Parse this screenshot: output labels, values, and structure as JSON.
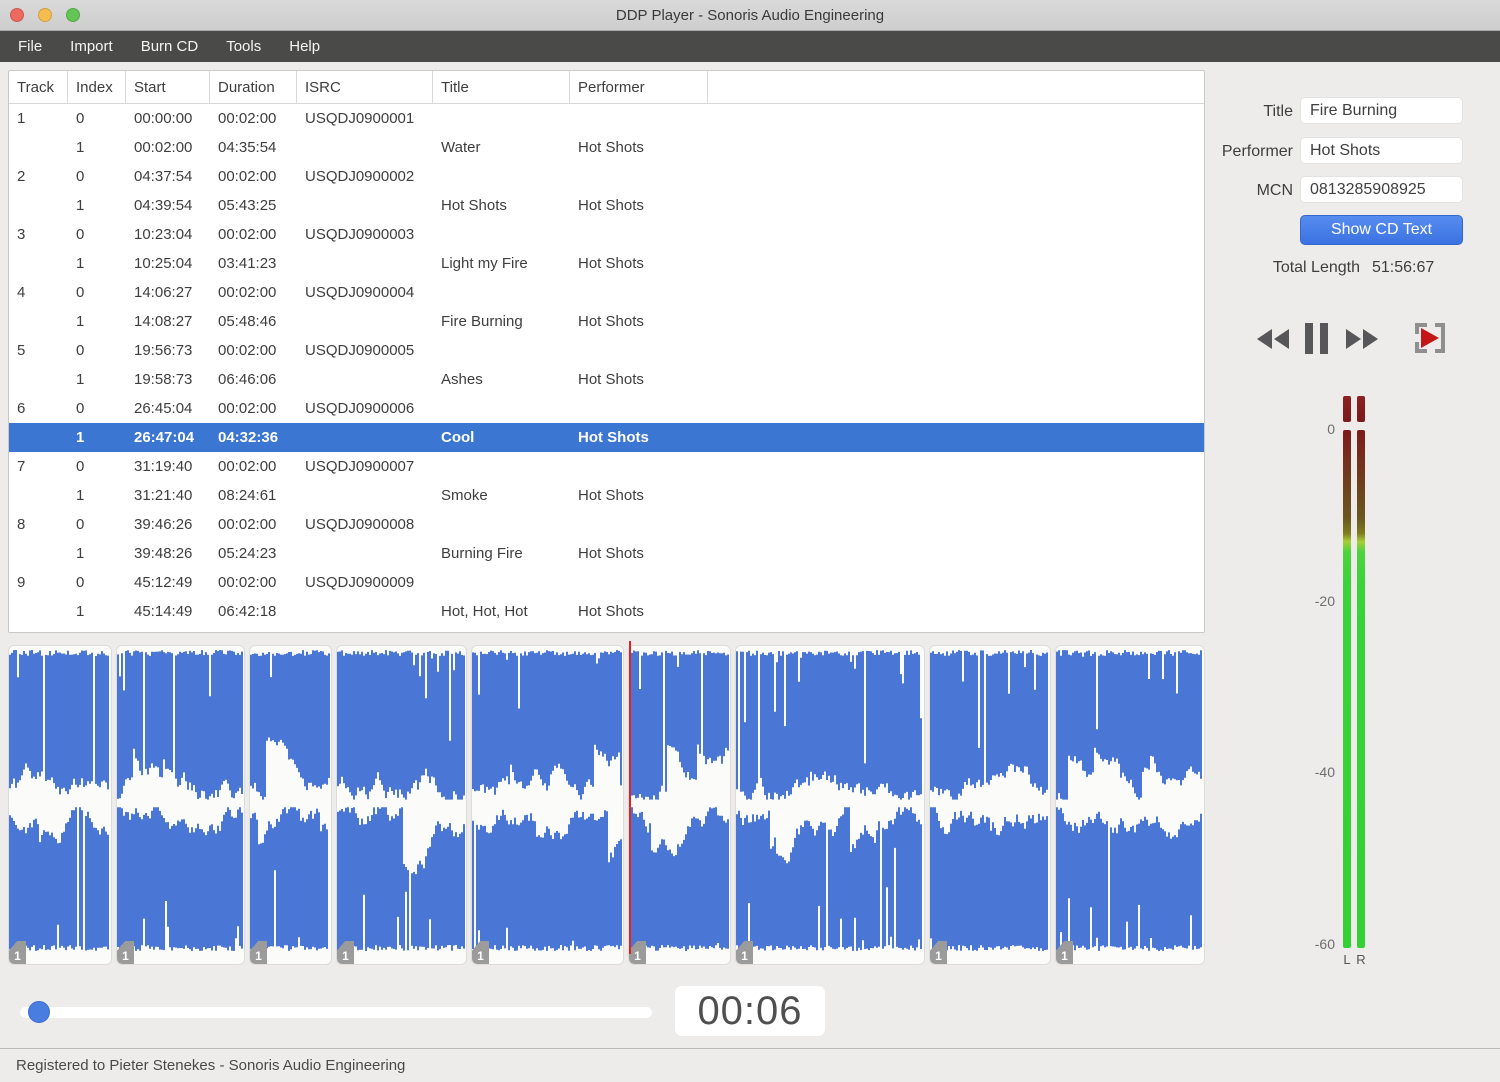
{
  "colors": {
    "selection": "#3b76d2",
    "waveform": "#4a77d6",
    "playhead": "#e02224",
    "button_blue_top": "#578cf0",
    "button_blue_bottom": "#3b72e1",
    "meter_green": "#3bd23b",
    "meter_clip_top": "#8e2020",
    "meter_clip_bottom": "#7a1a1a",
    "slider_thumb": "#4a7de0"
  },
  "window": {
    "title": "DDP Player - Sonoris Audio Engineering"
  },
  "menu": {
    "items": [
      "File",
      "Import",
      "Burn CD",
      "Tools",
      "Help"
    ]
  },
  "table": {
    "columns": [
      "Track",
      "Index",
      "Start",
      "Duration",
      "ISRC",
      "Title",
      "Performer"
    ],
    "rows": [
      {
        "track": "1",
        "index": "0",
        "start": "00:00:00",
        "duration": "00:02:00",
        "isrc": "USQDJ0900001",
        "title": "",
        "performer": ""
      },
      {
        "track": "",
        "index": "1",
        "start": "00:02:00",
        "duration": "04:35:54",
        "isrc": "",
        "title": "Water",
        "performer": "Hot Shots"
      },
      {
        "track": "2",
        "index": "0",
        "start": "04:37:54",
        "duration": "00:02:00",
        "isrc": "USQDJ0900002",
        "title": "",
        "performer": ""
      },
      {
        "track": "",
        "index": "1",
        "start": "04:39:54",
        "duration": "05:43:25",
        "isrc": "",
        "title": "Hot Shots",
        "performer": "Hot Shots"
      },
      {
        "track": "3",
        "index": "0",
        "start": "10:23:04",
        "duration": "00:02:00",
        "isrc": "USQDJ0900003",
        "title": "",
        "performer": ""
      },
      {
        "track": "",
        "index": "1",
        "start": "10:25:04",
        "duration": "03:41:23",
        "isrc": "",
        "title": "Light my Fire",
        "performer": "Hot Shots"
      },
      {
        "track": "4",
        "index": "0",
        "start": "14:06:27",
        "duration": "00:02:00",
        "isrc": "USQDJ0900004",
        "title": "",
        "performer": ""
      },
      {
        "track": "",
        "index": "1",
        "start": "14:08:27",
        "duration": "05:48:46",
        "isrc": "",
        "title": "Fire Burning",
        "performer": "Hot Shots"
      },
      {
        "track": "5",
        "index": "0",
        "start": "19:56:73",
        "duration": "00:02:00",
        "isrc": "USQDJ0900005",
        "title": "",
        "performer": ""
      },
      {
        "track": "",
        "index": "1",
        "start": "19:58:73",
        "duration": "06:46:06",
        "isrc": "",
        "title": "Ashes",
        "performer": "Hot Shots"
      },
      {
        "track": "6",
        "index": "0",
        "start": "26:45:04",
        "duration": "00:02:00",
        "isrc": "USQDJ0900006",
        "title": "",
        "performer": ""
      },
      {
        "track": "",
        "index": "1",
        "start": "26:47:04",
        "duration": "04:32:36",
        "isrc": "",
        "title": "Cool",
        "performer": "Hot Shots",
        "selected": true
      },
      {
        "track": "7",
        "index": "0",
        "start": "31:19:40",
        "duration": "00:02:00",
        "isrc": "USQDJ0900007",
        "title": "",
        "performer": ""
      },
      {
        "track": "",
        "index": "1",
        "start": "31:21:40",
        "duration": "08:24:61",
        "isrc": "",
        "title": "Smoke",
        "performer": "Hot Shots"
      },
      {
        "track": "8",
        "index": "0",
        "start": "39:46:26",
        "duration": "00:02:00",
        "isrc": "USQDJ0900008",
        "title": "",
        "performer": ""
      },
      {
        "track": "",
        "index": "1",
        "start": "39:48:26",
        "duration": "05:24:23",
        "isrc": "",
        "title": "Burning Fire",
        "performer": "Hot Shots"
      },
      {
        "track": "9",
        "index": "0",
        "start": "45:12:49",
        "duration": "00:02:00",
        "isrc": "USQDJ0900009",
        "title": "",
        "performer": ""
      },
      {
        "track": "",
        "index": "1",
        "start": "45:14:49",
        "duration": "06:42:18",
        "isrc": "",
        "title": "Hot, Hot, Hot",
        "performer": "Hot Shots"
      }
    ],
    "selected_row_index": 11
  },
  "cd_text": {
    "title_label": "Title",
    "title_value": "Fire Burning",
    "performer_label": "Performer",
    "performer_value": "Hot Shots",
    "mcn_label": "MCN",
    "mcn_value": "0813285908925",
    "show_button_label": "Show CD Text",
    "total_length_label": "Total Length",
    "total_length_value": "51:56:67"
  },
  "transport": {
    "buttons": [
      "rewind",
      "pause",
      "fast-forward",
      "play-from-marker"
    ],
    "time_display": "00:06"
  },
  "meter": {
    "ticks": [
      "0",
      "-20",
      "-40",
      "-60"
    ],
    "channel_labels": [
      "L",
      "R"
    ]
  },
  "waveform": {
    "playhead_block_index": 5,
    "blocks": [
      {
        "marker": "1",
        "duration_s": 276
      },
      {
        "marker": "1",
        "duration_s": 343
      },
      {
        "marker": "1",
        "duration_s": 221
      },
      {
        "marker": "1",
        "duration_s": 349
      },
      {
        "marker": "1",
        "duration_s": 406
      },
      {
        "marker": "1",
        "duration_s": 273
      },
      {
        "marker": "1",
        "duration_s": 505
      },
      {
        "marker": "1",
        "duration_s": 324
      },
      {
        "marker": "1",
        "duration_s": 402
      }
    ]
  },
  "status": {
    "text": "Registered to Pieter Stenekes - Sonoris Audio Engineering"
  }
}
